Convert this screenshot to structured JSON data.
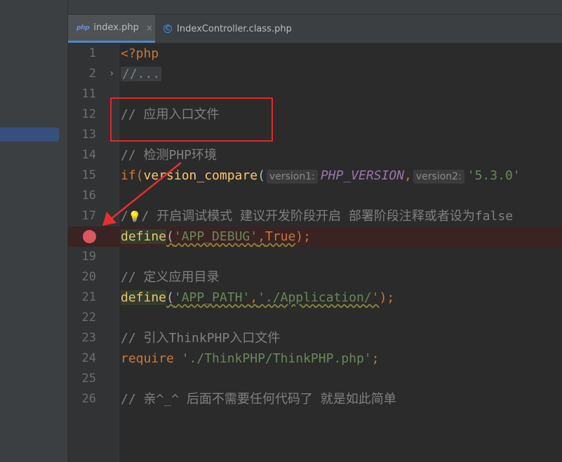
{
  "tabs": [
    {
      "label": "index.php",
      "badge": "php",
      "close": "×",
      "active": true
    },
    {
      "label": "IndexController.class.php",
      "badge": "C",
      "active": false
    }
  ],
  "lines": [
    {
      "num": "1",
      "fold": "",
      "breakpoint": false
    },
    {
      "num": "2",
      "fold": "›",
      "breakpoint": false
    },
    {
      "num": "11",
      "fold": "",
      "breakpoint": false
    },
    {
      "num": "12",
      "fold": "",
      "breakpoint": false
    },
    {
      "num": "13",
      "fold": "",
      "breakpoint": false
    },
    {
      "num": "14",
      "fold": "",
      "breakpoint": false
    },
    {
      "num": "15",
      "fold": "",
      "breakpoint": false
    },
    {
      "num": "16",
      "fold": "",
      "breakpoint": false
    },
    {
      "num": "17",
      "fold": "",
      "breakpoint": false
    },
    {
      "num": "",
      "fold": "",
      "breakpoint": true
    },
    {
      "num": "19",
      "fold": "",
      "breakpoint": false
    },
    {
      "num": "20",
      "fold": "",
      "breakpoint": false
    },
    {
      "num": "21",
      "fold": "",
      "breakpoint": false
    },
    {
      "num": "22",
      "fold": "",
      "breakpoint": false
    },
    {
      "num": "23",
      "fold": "",
      "breakpoint": false
    },
    {
      "num": "24",
      "fold": "",
      "breakpoint": false
    },
    {
      "num": "25",
      "fold": "",
      "breakpoint": false
    },
    {
      "num": "26",
      "fold": "",
      "breakpoint": false
    }
  ],
  "code": {
    "l1": "<?php",
    "l2": "//...",
    "l12": "// 应用入口文件",
    "l14": "// 检测PHP环境",
    "l15_if": "if(",
    "l15_fn": "version_compare",
    "l15_paren": "(",
    "l15_hint1": "version1:",
    "l15_const": "PHP_VERSION",
    "l15_comma": ",",
    "l15_hint2": "version2:",
    "l15_str": "'5.3.0'",
    "l17_slash1": "/",
    "l17_slash2": "/",
    "l17_text": " 开启调试模式 建议开发阶段开启 部署阶段注释或者设为false",
    "l18_fn": "define",
    "l18_open": "(",
    "l18_str": "'APP_DEBUG'",
    "l18_comma": ",",
    "l18_true": "True",
    "l18_close": ");",
    "l20": "// 定义应用目录",
    "l21_fn": "define",
    "l21_open": "(",
    "l21_str1": "'APP_PATH'",
    "l21_comma": ",",
    "l21_str2": "'./Application/'",
    "l21_close": ");",
    "l23": "// 引入ThinkPHP入口文件",
    "l24_kw": "require",
    "l24_str": "'./ThinkPHP/ThinkPHP.php'",
    "l24_end": ";",
    "l26": "// 亲^_^ 后面不需要任何代码了 就是如此简单"
  },
  "icons": {
    "bulb": "💡"
  }
}
